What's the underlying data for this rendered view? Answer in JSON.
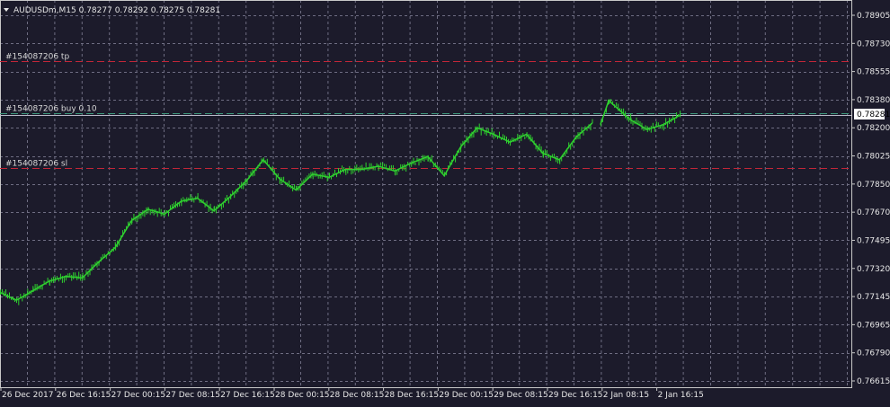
{
  "colors": {
    "background": "#1c1b2b",
    "grid": "#6e6d82",
    "frame": "#c8c8c8",
    "candles": "#2fd12f",
    "tp_sl_line": "#c22638",
    "entry_line": "#3e9a7e",
    "bid_line": "#b8b8c8",
    "text": "#e6e6e6",
    "price_tag_bg": "#ffffff"
  },
  "header": {
    "menu_icon": "triangle-down-icon",
    "title": "AUDUSDm,M15  0.78277 0.78292 0.78275 0.78281"
  },
  "chart_data": {
    "type": "line",
    "symbol": "AUDUSDm",
    "timeframe": "M15",
    "ohlc": {
      "open": 0.78277,
      "high": 0.78292,
      "low": 0.78275,
      "close": 0.78281
    },
    "x_tick_labels": [
      "26 Dec 2017",
      "26 Dec 16:15",
      "27 Dec 00:15",
      "27 Dec 08:15",
      "27 Dec 16:15",
      "28 Dec 00:15",
      "28 Dec 08:15",
      "28 Dec 16:15",
      "29 Dec 00:15",
      "29 Dec 08:15",
      "29 Dec 16:15",
      "2 Jan 08:15",
      "2 Jan 16:15"
    ],
    "y_tick_labels": [
      "0.78905",
      "0.78730",
      "0.78555",
      "0.78380",
      "0.78200",
      "0.78025",
      "0.77850",
      "0.77670",
      "0.77495",
      "0.77320",
      "0.77145",
      "0.76965",
      "0.76790",
      "0.76615"
    ],
    "ylim": [
      0.76615,
      0.78905
    ],
    "grid": true,
    "series": [
      {
        "x": [
          0,
          0.3,
          0.6,
          0.9,
          1.2,
          1.5,
          1.8,
          2.1,
          2.4,
          2.7,
          3.0,
          3.3,
          3.6,
          3.9,
          4.2,
          4.5,
          4.8,
          5.1,
          5.4,
          5.7,
          6.0,
          6.3,
          6.6,
          6.9,
          7.2,
          7.5,
          7.8,
          8.1,
          8.4,
          8.7,
          9.0,
          9.3,
          9.6,
          9.9,
          10.2,
          10.5,
          10.8,
          10.95,
          11.1,
          11.5,
          11.8,
          12.1,
          12.4
        ],
        "y": [
          0.7717,
          0.7712,
          0.7718,
          0.7724,
          0.7727,
          0.7726,
          0.7736,
          0.7745,
          0.7762,
          0.7769,
          0.7766,
          0.7774,
          0.7776,
          0.7768,
          0.7777,
          0.7787,
          0.78,
          0.7788,
          0.7781,
          0.7791,
          0.7789,
          0.7794,
          0.7794,
          0.7796,
          0.7793,
          0.7798,
          0.7802,
          0.779,
          0.7808,
          0.782,
          0.7816,
          0.7811,
          0.7816,
          0.7804,
          0.78,
          0.7814,
          0.7823,
          0.7822,
          0.7837,
          0.7825,
          0.7819,
          0.7822,
          0.7828
        ]
      }
    ],
    "gap_after_index": 36,
    "horizontal_lines": [
      {
        "label": "#154087206 tp",
        "price": 0.7862,
        "color": "#c22638",
        "style": "dash"
      },
      {
        "label": "#154087206 buy 0.10",
        "price": 0.7829,
        "color": "#3e9a7e",
        "style": "dash"
      },
      {
        "label": "#154087206 sl",
        "price": 0.7795,
        "color": "#c22638",
        "style": "dash"
      },
      {
        "label": "",
        "price": 0.78281,
        "color": "#b8b8c8",
        "style": "solid"
      }
    ],
    "current_price_tag": "0.78281"
  }
}
